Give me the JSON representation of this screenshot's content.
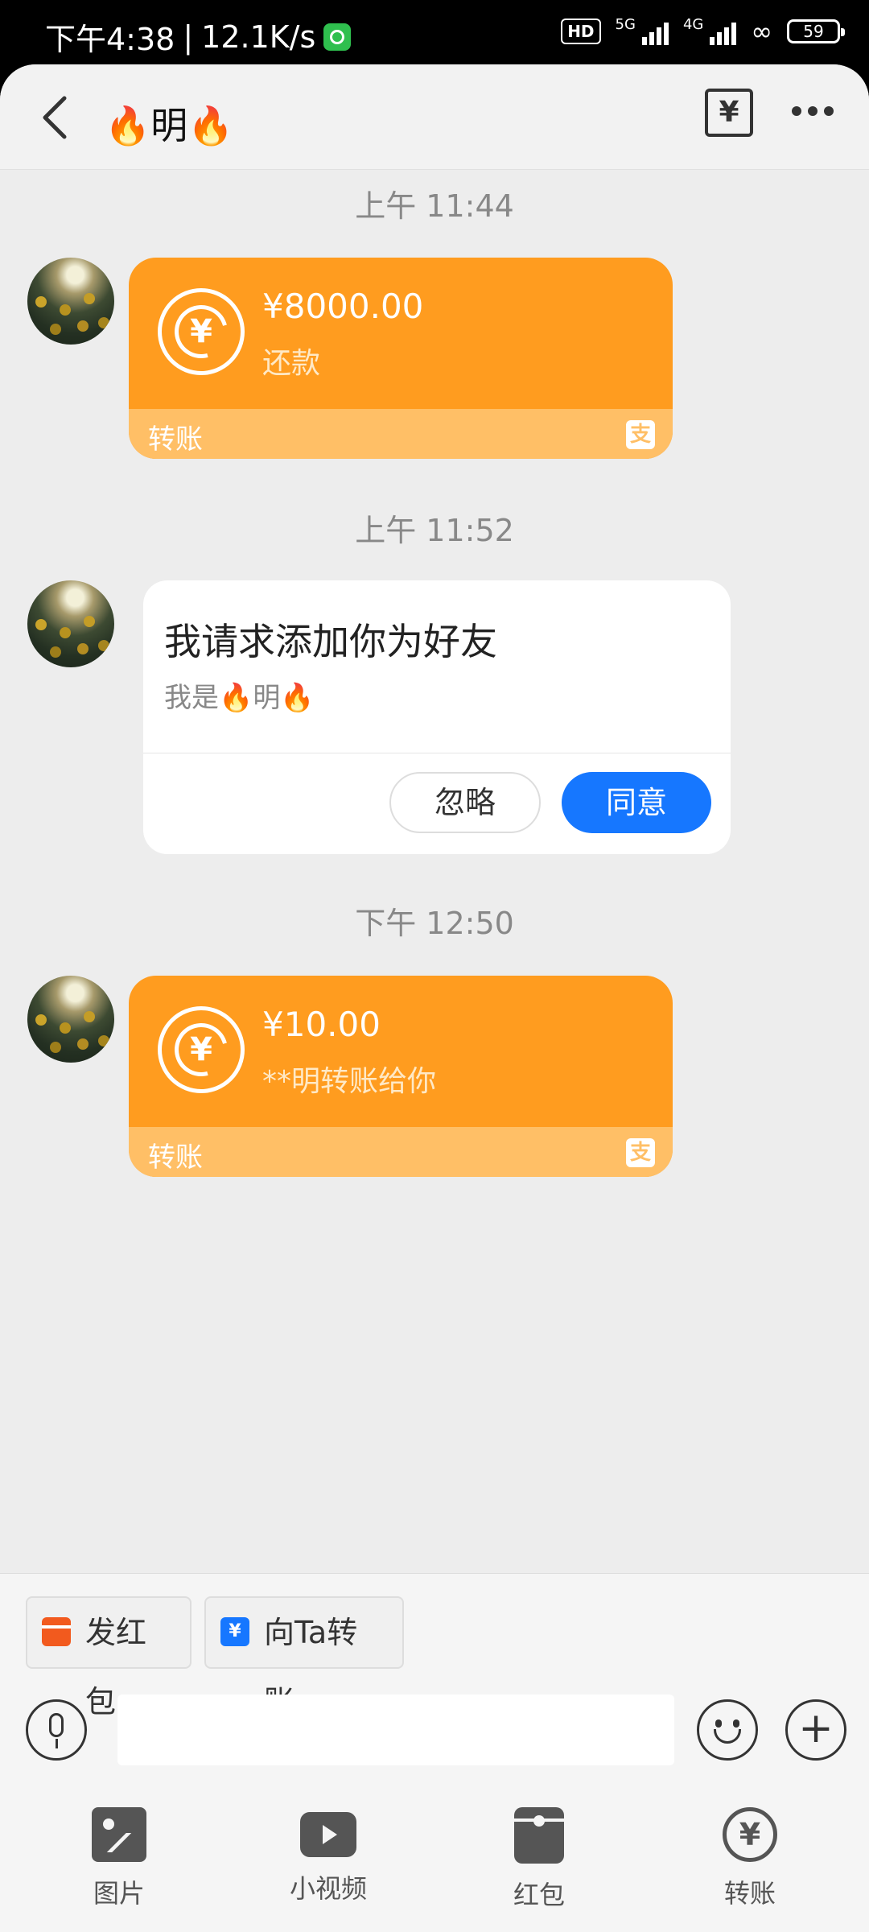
{
  "status_bar": {
    "time": "下午4:38",
    "speed": "12.1K/s",
    "hd": "HD",
    "net1": "5G",
    "net2": "4G",
    "battery": "59"
  },
  "header": {
    "title": "🔥明🔥",
    "yen_icon": "¥"
  },
  "messages": [
    {
      "time": "上午 11:44",
      "type": "transfer",
      "amount": "¥8000.00",
      "note": "还款",
      "label": "转账",
      "alipay_glyph": "支"
    },
    {
      "time": "上午 11:52",
      "type": "friend_request",
      "title": "我请求添加你为好友",
      "subtitle": "我是🔥明🔥",
      "ignore_label": "忽略",
      "agree_label": "同意"
    },
    {
      "time": "下午 12:50",
      "type": "transfer",
      "amount": "¥10.00",
      "note": "**明转账给你",
      "label": "转账",
      "alipay_glyph": "支"
    }
  ],
  "quick_actions": [
    {
      "label": "发红包",
      "icon": "red-packet-icon"
    },
    {
      "label": "向Ta转账",
      "icon": "transfer-icon",
      "glyph": "¥"
    }
  ],
  "input": {
    "placeholder": ""
  },
  "toolbar": [
    {
      "label": "图片",
      "icon": "picture-icon"
    },
    {
      "label": "小视频",
      "icon": "video-icon"
    },
    {
      "label": "红包",
      "icon": "red-packet-icon"
    },
    {
      "label": "转账",
      "icon": "transfer-icon",
      "glyph": "¥"
    }
  ],
  "colors": {
    "transfer_orange": "#ff9c1f",
    "transfer_footer": "#ffbf66",
    "agree_blue": "#1677ff",
    "background": "#ededed"
  }
}
